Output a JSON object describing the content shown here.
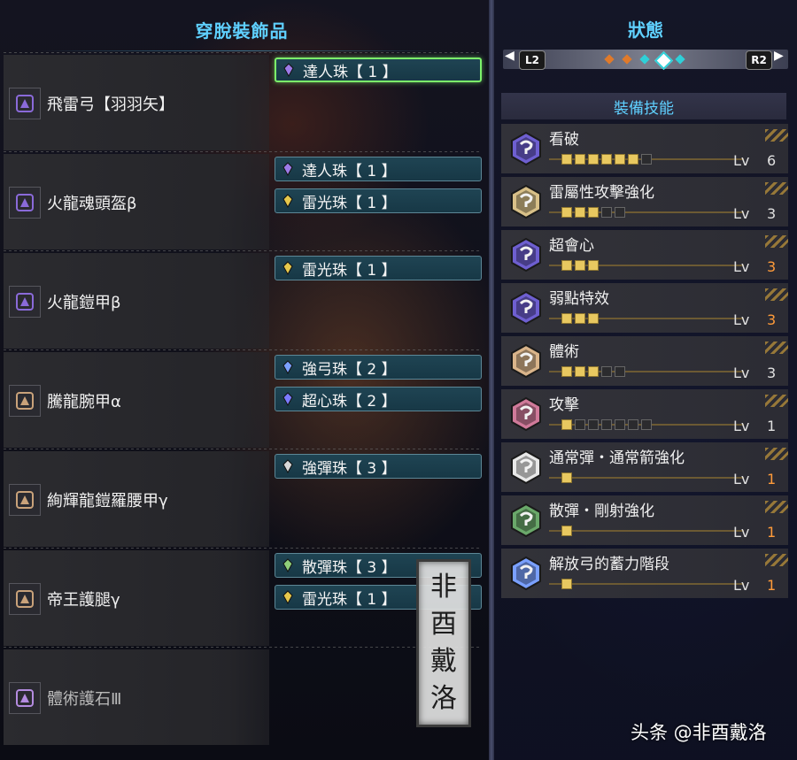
{
  "left_panel": {
    "title": "穿脫裝飾品",
    "equipment": [
      {
        "icon": "bow-icon",
        "icon_color": "#8a6ad9",
        "name": "飛雷弓【羽羽矢】",
        "decorations": [
          {
            "name": "達人珠【 1 】",
            "gem_color": "#9c7be8",
            "selected": true
          }
        ]
      },
      {
        "icon": "helmet-icon",
        "icon_color": "#8a6ad9",
        "name": "火龍魂頭盔β",
        "decorations": [
          {
            "name": "達人珠【 1 】",
            "gem_color": "#9c7be8",
            "selected": false
          },
          {
            "name": "雷光珠【 1 】",
            "gem_color": "#e6c84c",
            "selected": false
          }
        ]
      },
      {
        "icon": "chest-armor-icon",
        "icon_color": "#8a6ad9",
        "name": "火龍鎧甲β",
        "decorations": [
          {
            "name": "雷光珠【 1 】",
            "gem_color": "#e6c84c",
            "selected": false
          }
        ]
      },
      {
        "icon": "gauntlet-icon",
        "icon_color": "#c9a27a",
        "name": "騰龍腕甲α",
        "decorations": [
          {
            "name": "強弓珠【 2 】",
            "gem_color": "#7aa0ff",
            "selected": false
          },
          {
            "name": "超心珠【 2 】",
            "gem_color": "#7b7bff",
            "selected": false
          }
        ]
      },
      {
        "icon": "waist-icon",
        "icon_color": "#c9a27a",
        "name": "絢輝龍鎧羅腰甲γ",
        "decorations": [
          {
            "name": "強彈珠【 3 】",
            "gem_color": "#d8d8d8",
            "selected": false
          }
        ]
      },
      {
        "icon": "leg-armor-icon",
        "icon_color": "#c9a27a",
        "name": "帝王護腿γ",
        "decorations": [
          {
            "name": "散彈珠【 3 】",
            "gem_color": "#8fcf7a",
            "selected": false
          },
          {
            "name": "雷光珠【 1 】",
            "gem_color": "#e6c84c",
            "selected": false
          }
        ]
      },
      {
        "icon": "charm-icon",
        "icon_color": "#b48be0",
        "name": "體術護石Ⅲ",
        "dim": true,
        "decorations": []
      }
    ]
  },
  "stamp_text": [
    "非",
    "酉",
    "戴",
    "洛"
  ],
  "right_panel": {
    "title": "狀態",
    "left_button": "L2",
    "right_button": "R2",
    "nav_dots": [
      {
        "color": "#e07a2a",
        "active": false
      },
      {
        "color": "#e07a2a",
        "active": false
      },
      {
        "color": "#2fd0d8",
        "active": false
      },
      {
        "color": "#2fd0d8",
        "active": true
      },
      {
        "color": "#2fd0d8",
        "active": false
      }
    ],
    "skills_header": "裝備技能",
    "level_prefix": "Lv",
    "skills": [
      {
        "name": "看破",
        "icon_color": "#6e5fd0",
        "level": 6,
        "max_level": 7,
        "is_max": false
      },
      {
        "name": "雷屬性攻擊強化",
        "icon_color": "#d8c088",
        "level": 3,
        "max_level": 5,
        "is_max": false
      },
      {
        "name": "超會心",
        "icon_color": "#6e5fd0",
        "level": 3,
        "max_level": 3,
        "is_max": true
      },
      {
        "name": "弱點特效",
        "icon_color": "#6e5fd0",
        "level": 3,
        "max_level": 3,
        "is_max": true
      },
      {
        "name": "體術",
        "icon_color": "#d9b48a",
        "level": 3,
        "max_level": 5,
        "is_max": false
      },
      {
        "name": "攻擊",
        "icon_color": "#d07a9a",
        "level": 1,
        "max_level": 7,
        "is_max": false
      },
      {
        "name": "通常彈・通常箭強化",
        "icon_color": "#e8e8e8",
        "level": 1,
        "max_level": 1,
        "is_max": true
      },
      {
        "name": "散彈・剛射強化",
        "icon_color": "#6aa86a",
        "level": 1,
        "max_level": 1,
        "is_max": true
      },
      {
        "name": "解放弓的蓄力階段",
        "icon_color": "#7aa0ff",
        "level": 1,
        "max_level": 1,
        "is_max": true
      }
    ]
  },
  "watermark": "头条 @非酉戴洛"
}
